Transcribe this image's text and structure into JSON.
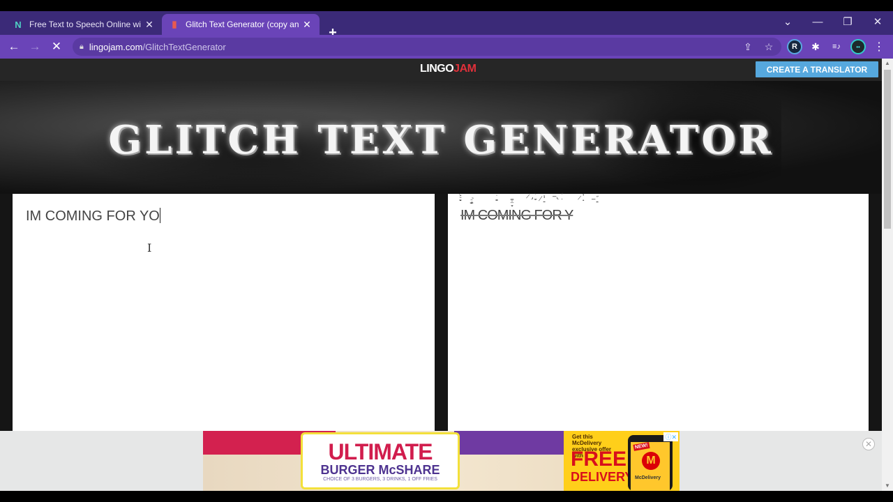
{
  "browser": {
    "tabs": [
      {
        "title": "Free Text to Speech Online with N",
        "favicon": "N",
        "active": false
      },
      {
        "title": "Glitch Text Generator (copy and p",
        "favicon": "▮",
        "active": true
      }
    ],
    "new_tab": "+",
    "window_controls": {
      "dropdown": "⌄",
      "minimize": "—",
      "restore": "❐",
      "close": "✕"
    },
    "nav": {
      "back": "←",
      "forward": "→",
      "stop": "✕"
    },
    "url_domain": "lingojam.com",
    "url_path": "/GlitchTextGenerator",
    "toolbar_icons": {
      "share": "⇪",
      "bookmark": "☆",
      "extension_r": "R",
      "extensions": "✱",
      "media": "≡♪",
      "profile": "••",
      "menu": "⋮"
    }
  },
  "site": {
    "logo_part1": "LINGO",
    "logo_part2": "JAM",
    "create_button": "CREATE A TRANSLATOR",
    "hero_title": "GLITCH TEXT GENERATOR"
  },
  "translator": {
    "input_value": "IM COMING FOR YO",
    "output_value": "IM COMING FOR Y",
    "glitch_marks": [
      "̴͖̟̬͍͐̈́",
      "̵̡̘͇̠̃",
      "͚̼̫̍",
      "̶̻̫͉̆̿",
      "̷̡̝̤̀",
      "̸̱̤̓̒",
      "̶̢̣̈́",
      "̷̜̠̉",
      "̶̤̪̋"
    ]
  },
  "ad": {
    "headline": "ULTIMATE",
    "subheadline": "BURGER McSHARE",
    "fine_print": "CHOICE OF 3 BURGERS, 3 DRINKS, 1 OFF FRIES",
    "promo_line": "Get this McDelivery exclusive offer with",
    "free": "FREE",
    "delivery": "DELIVERY",
    "badge_new": "NEW!",
    "app_name": "McDelivery",
    "brand_mark": "M",
    "adchoices": "ⓘ✕",
    "close": "✕"
  },
  "scrollbar": {
    "up": "▲",
    "down": "▼"
  }
}
